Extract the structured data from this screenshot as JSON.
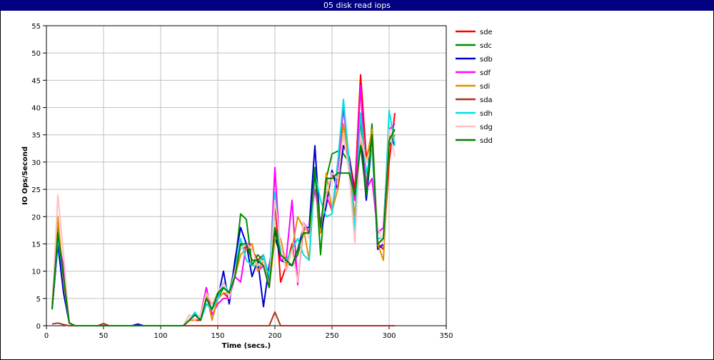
{
  "chart_data": {
    "type": "line",
    "title": "05 disk read iops",
    "xlabel": "Time (secs.)",
    "ylabel": "IO Ops/Second",
    "xlim": [
      0,
      350
    ],
    "ylim": [
      0,
      55
    ],
    "xticks": [
      0,
      50,
      100,
      150,
      200,
      250,
      300,
      350
    ],
    "yticks": [
      0,
      5,
      10,
      15,
      20,
      25,
      30,
      35,
      40,
      45,
      50,
      55
    ],
    "grid": true,
    "legend_position": "right",
    "x": [
      5,
      10,
      15,
      20,
      25,
      30,
      35,
      40,
      45,
      50,
      55,
      60,
      65,
      70,
      75,
      80,
      85,
      90,
      95,
      100,
      105,
      110,
      115,
      120,
      125,
      130,
      135,
      140,
      145,
      150,
      155,
      160,
      165,
      170,
      175,
      180,
      185,
      190,
      195,
      200,
      205,
      210,
      215,
      220,
      225,
      230,
      235,
      240,
      245,
      250,
      255,
      260,
      265,
      270,
      275,
      280,
      285,
      290,
      295,
      300,
      305
    ],
    "series": [
      {
        "name": "sde",
        "color": "#ff0000",
        "values": [
          3,
          15,
          10,
          0.5,
          0,
          0,
          0,
          0,
          0,
          0,
          0,
          0,
          0,
          0,
          0,
          0,
          0,
          0,
          0,
          0,
          0,
          0,
          0,
          0,
          1,
          1,
          1,
          6,
          4,
          5,
          6,
          5,
          10,
          15,
          14,
          14,
          12,
          13,
          7,
          23,
          8,
          11,
          15,
          8,
          18,
          17,
          28,
          18,
          24,
          28,
          25,
          33,
          31,
          25,
          46,
          31,
          34,
          15,
          14,
          30,
          39
        ]
      },
      {
        "name": "sdc",
        "color": "#009000",
        "values": [
          3,
          18,
          10,
          0.5,
          0,
          0,
          0,
          0,
          0,
          0,
          0,
          0,
          0,
          0,
          0,
          0,
          0,
          0,
          0,
          0,
          0,
          0,
          0,
          0,
          1,
          2,
          1,
          5,
          3,
          5,
          7,
          6,
          11,
          20.5,
          19.5,
          11,
          13,
          12,
          8,
          16,
          13,
          12,
          11,
          13,
          17,
          17,
          29,
          13,
          27,
          31.5,
          32,
          31.5,
          30,
          23,
          38,
          25,
          37,
          15,
          16,
          33,
          35
        ]
      },
      {
        "name": "sdb",
        "color": "#0000d0",
        "values": [
          3,
          15,
          6,
          0.5,
          0,
          0,
          0,
          0,
          0,
          0,
          0,
          0,
          0,
          0,
          0,
          0.3,
          0,
          0,
          0,
          0,
          0,
          0,
          0,
          0,
          1,
          2,
          1,
          4,
          3,
          5,
          10,
          4,
          12,
          18,
          15,
          9,
          12,
          3.5,
          11,
          17.5,
          12,
          11.5,
          11,
          14,
          18,
          18,
          33,
          17,
          22,
          28.5,
          25,
          33,
          31,
          23,
          35,
          23,
          34,
          14,
          15,
          35,
          33
        ]
      },
      {
        "name": "sdf",
        "color": "#ff00ff",
        "values": [
          3,
          16,
          11,
          0.5,
          0,
          0,
          0,
          0,
          0,
          0,
          0,
          0,
          0,
          0,
          0,
          0,
          0,
          0,
          0,
          0,
          0,
          0,
          0,
          0,
          2,
          1,
          2,
          7,
          2,
          4,
          5,
          5,
          9,
          8,
          15,
          15,
          10,
          11,
          7,
          29,
          12,
          12.5,
          23,
          7.5,
          19,
          17,
          25,
          19,
          24,
          21,
          28,
          40,
          30,
          23,
          44,
          25,
          27,
          17,
          18,
          36,
          37
        ]
      },
      {
        "name": "sdi",
        "color": "#e09000",
        "values": [
          4,
          20,
          8,
          0.5,
          0,
          0,
          0,
          0,
          0,
          0,
          0,
          0,
          0,
          0,
          0,
          0,
          0,
          0,
          0,
          0,
          0,
          0,
          0,
          0,
          1,
          1,
          2,
          6,
          1,
          5,
          6,
          6,
          9,
          13,
          14,
          15,
          10,
          12,
          7,
          16,
          16,
          11,
          14,
          20,
          18,
          12,
          28,
          17,
          28,
          21,
          25,
          37,
          30,
          20,
          34,
          30,
          36,
          15,
          12,
          34,
          35
        ]
      },
      {
        "name": "sda",
        "color": "#b03020",
        "values": [
          0.3,
          0.5,
          0.2,
          0,
          0,
          0,
          0,
          0,
          0,
          0.4,
          0,
          0,
          0,
          0,
          0,
          0,
          0,
          0,
          0,
          0,
          0,
          0,
          0,
          0,
          0,
          0,
          0,
          0,
          0,
          0,
          0,
          0,
          0,
          0,
          0,
          0,
          0,
          0,
          0,
          2.5,
          0,
          0,
          0,
          0,
          0,
          0,
          0,
          0,
          0,
          0,
          0,
          0,
          0,
          0,
          0,
          0,
          0,
          0,
          0,
          0,
          0
        ]
      },
      {
        "name": "sdh",
        "color": "#00e0e0",
        "values": [
          3,
          16,
          9,
          0.5,
          0,
          0,
          0,
          0,
          0,
          0,
          0,
          0,
          0,
          0,
          0,
          0,
          0,
          0,
          0,
          0,
          0,
          0,
          0,
          0,
          1,
          2.5,
          1,
          4,
          3,
          5,
          8,
          6,
          10,
          16,
          12,
          11,
          11,
          13,
          9,
          24.5,
          13,
          12,
          14,
          16,
          13,
          12,
          28,
          23,
          20,
          20.5,
          30,
          41.5,
          30,
          17.5,
          39,
          28,
          32,
          16,
          16,
          39.5,
          33
        ]
      },
      {
        "name": "sdg",
        "color": "#ffc0c0",
        "values": [
          3,
          24,
          13,
          0.5,
          0,
          0,
          0,
          0,
          0,
          0,
          0,
          0,
          0,
          0,
          0,
          0,
          0,
          0,
          0,
          0,
          0,
          0,
          0,
          0,
          2,
          1,
          2,
          6,
          4,
          6,
          8,
          5,
          10,
          14,
          15,
          14,
          11,
          12,
          7,
          23,
          15,
          10,
          14,
          8,
          19,
          16,
          28,
          18,
          24,
          28,
          27,
          35,
          28,
          15,
          35,
          30,
          33,
          18,
          15,
          36,
          31
        ]
      },
      {
        "name": "sdd",
        "color": "#008000",
        "values": [
          3,
          17,
          9,
          0.5,
          0,
          0,
          0,
          0,
          0,
          0,
          0,
          0,
          0,
          0,
          0,
          0,
          0,
          0,
          0,
          0,
          0,
          0,
          0,
          0,
          1,
          2,
          1,
          5,
          3,
          6,
          7,
          6,
          9,
          15,
          15,
          12,
          12,
          11,
          7,
          18,
          13,
          12,
          11,
          14,
          17,
          17,
          28,
          18,
          27,
          27,
          28,
          28,
          28,
          24,
          33,
          24,
          35,
          15,
          16,
          34,
          36
        ]
      }
    ]
  }
}
